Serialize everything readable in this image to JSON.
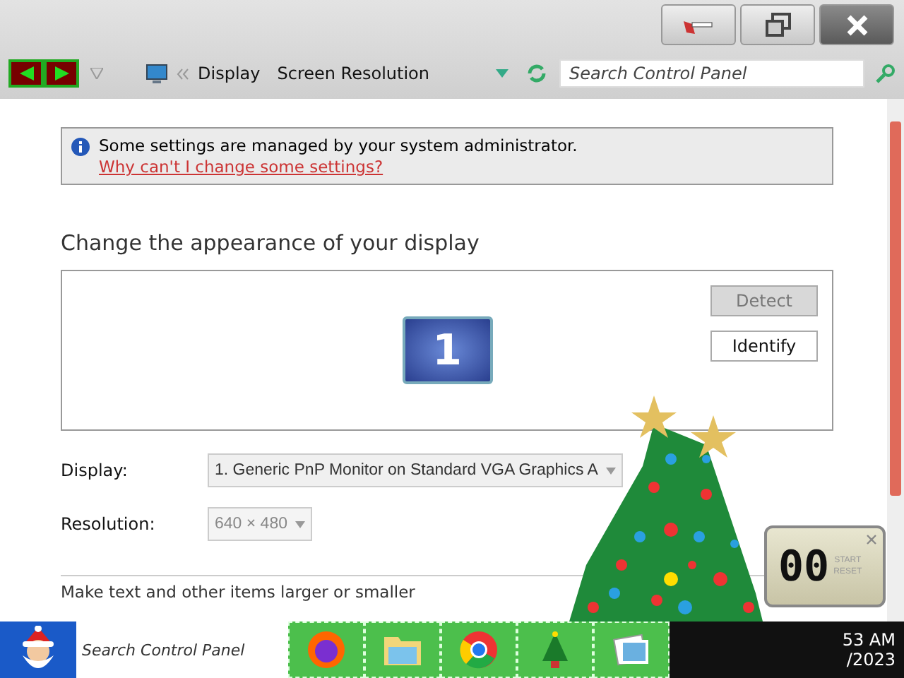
{
  "address_bar": {
    "breadcrumbs": [
      "Display",
      "Screen Resolution"
    ],
    "search": {
      "placeholder": "Search Control Panel"
    }
  },
  "notice": {
    "text": "Some settings are managed by your system administrator.",
    "link": "Why can't I change some settings?"
  },
  "heading": "Change the appearance of your display",
  "monitor_preview": {
    "monitor_label": "1",
    "buttons": [
      {
        "label": "Detect",
        "disabled": true
      },
      {
        "label": "Identify",
        "disabled": false
      }
    ]
  },
  "settings": [
    {
      "label": "Display:",
      "value": "1. Generic PnP Monitor on Standard VGA Graphics A",
      "disabled": false
    },
    {
      "label": "Resolution:",
      "value": "640 × 480",
      "disabled": true
    }
  ],
  "footer_link": "Make text and other items larger or smaller",
  "timer": {
    "display": "00",
    "buttons": [
      "START",
      "RESET"
    ]
  },
  "taskbar": {
    "search": {
      "placeholder": "Search Control Panel"
    },
    "apps": [
      {
        "kind": "firefox"
      },
      {
        "kind": "folder"
      },
      {
        "kind": "chrome"
      },
      {
        "kind": "tree"
      },
      {
        "kind": "photos"
      }
    ],
    "clock": {
      "time": "53 AM",
      "date": "/2023"
    }
  }
}
